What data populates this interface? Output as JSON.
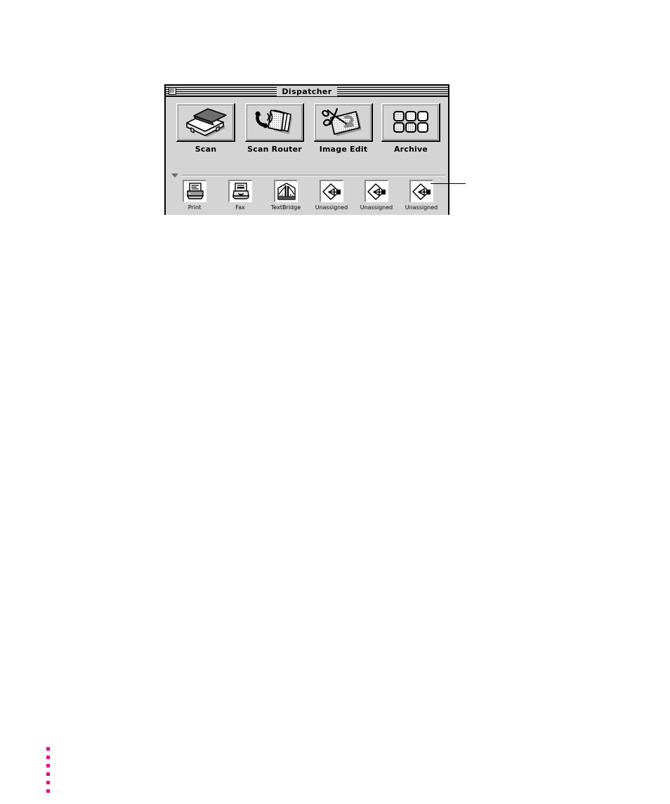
{
  "window": {
    "title": "Dispatcher",
    "close_box_name": "close-box",
    "bg_color": "#d4d4d4",
    "border_color": "#000000"
  },
  "primary_row": {
    "items": [
      {
        "label": "Scan",
        "icon": "scanner-icon"
      },
      {
        "label": "Scan Router",
        "icon": "phone-documents-icon"
      },
      {
        "label": "Image Edit",
        "icon": "scissors-image-icon"
      },
      {
        "label": "Archive",
        "icon": "grid-thumbnails-icon"
      }
    ]
  },
  "divider": {
    "disclosure_icon": "triangle-down-icon"
  },
  "secondary_row": {
    "items": [
      {
        "label": "Print",
        "icon": "printer-icon"
      },
      {
        "label": "Fax",
        "icon": "fax-machine-icon"
      },
      {
        "label": "TextBridge",
        "icon": "bridge-icon"
      },
      {
        "label": "Unassigned",
        "icon": "diamond-plug-icon"
      },
      {
        "label": "Unassigned",
        "icon": "diamond-plug-icon"
      },
      {
        "label": "Unassigned",
        "icon": "diamond-plug-icon"
      }
    ]
  },
  "annotation": {
    "callout_line": "leader-line-to-last-unassigned"
  },
  "registration_marks": {
    "color": "#ec008c",
    "count": 6
  }
}
